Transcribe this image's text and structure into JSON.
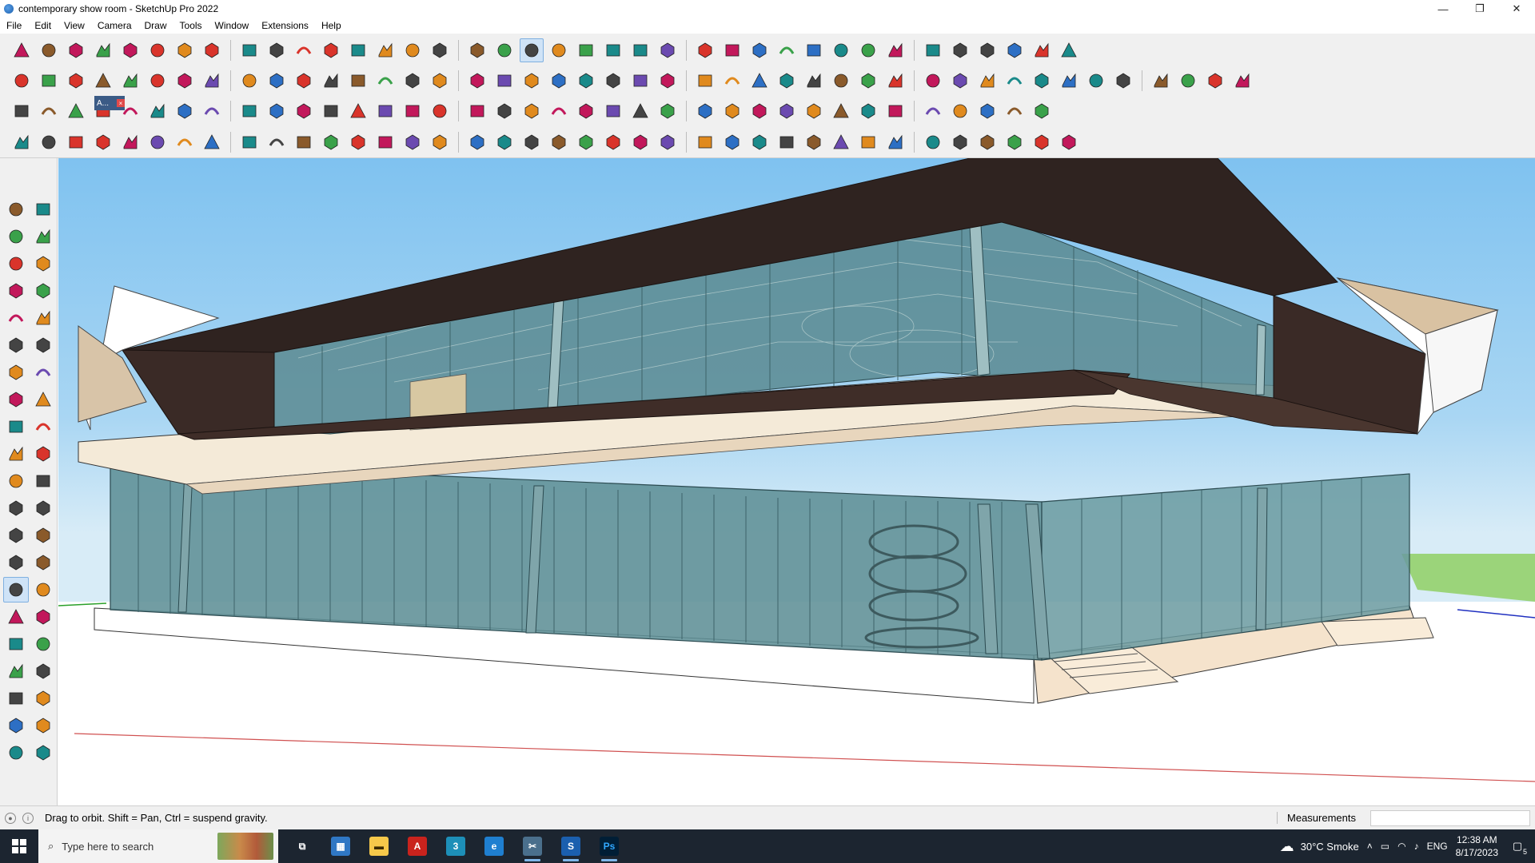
{
  "window": {
    "title": "contemporary show room - SketchUp Pro 2022",
    "minimize_glyph": "—",
    "maximize_glyph": "❐",
    "close_glyph": "✕"
  },
  "menu": [
    "File",
    "Edit",
    "View",
    "Camera",
    "Draw",
    "Tools",
    "Window",
    "Extensions",
    "Help"
  ],
  "toolbar": {
    "active_tool": "orbit-icon",
    "row1": [
      "zoom-icon",
      "select-icon",
      "select-dropdown-icon",
      "eraser-icon",
      "line-icon",
      "line-dropdown-icon",
      "arc-icon",
      "arc-dropdown-icon",
      "shape-icon",
      "shape-dropdown-icon",
      "pushpull-icon",
      "followme-icon",
      "move-icon",
      "rotate-icon",
      "scale-icon",
      "tapemeasure-icon",
      "text-icon",
      "paint-icon",
      "orbit-icon",
      "pan-icon",
      "zoom-tool-icon",
      "zoom-extents-icon",
      "geo-icon",
      "sandbox-icon",
      "layers-icon",
      "warehouse-icon",
      "user-icon",
      "user-dropdown-icon",
      "section-icon",
      "section-fill-icon",
      "solid-icon",
      "flip-icon",
      "flip2-icon",
      "axes-icon",
      "xray-icon",
      "undo-icon",
      "redo-icon",
      "hand-icon"
    ],
    "row2": [
      "component-icon",
      "component2-icon",
      "component3-icon",
      "pushpull-red-icon",
      "extrude-a-icon",
      "extrude-b-icon",
      "extrude-c-icon",
      "extrude-d-icon",
      "extrude-e-icon",
      "extrude-f-icon",
      "curve-icon",
      "wall-a-icon",
      "wall-b-icon",
      "wall-c-icon",
      "face-icon",
      "face2-icon",
      "house-a-icon",
      "house-b-icon",
      "house-c-icon",
      "house-d-icon",
      "house-e-icon",
      "house-f-icon",
      "fx-icon",
      "leaf-icon",
      "pencil-red-icon",
      "shape-a-icon",
      "shape-b-icon",
      "shape-c-icon",
      "shape-d-icon",
      "shape-e-icon",
      "shape-f-icon",
      "shape-g-icon",
      "shape-h-icon",
      "shape-i-icon",
      "shape-j-icon",
      "ruler-icon",
      "eraser-pink-icon",
      "stamp-a-icon",
      "stamp-b-icon",
      "stamp-c-icon",
      "stamp-d-icon",
      "stamp-e-icon",
      "stamp-f-icon",
      "stamp-g-icon"
    ],
    "row3": [
      "plane-a-icon",
      "plane-b-icon",
      "plane-c-icon",
      "plane-d-icon",
      "plane-e-icon",
      "arc-orange-icon",
      "rect-red-icon",
      "grid-icon",
      "panel-icon",
      "box-icon",
      "chain-icon",
      "curve2-icon",
      "spline-icon",
      "cross-red-icon",
      "cross-green-icon",
      "cross-blue-icon",
      "cone-icon",
      "cone2-icon",
      "triangle-icon",
      "loop-icon",
      "loop2-icon",
      "loop3-icon",
      "move2-icon",
      "bucket-icon",
      "undo-red-icon",
      "tree-icon",
      "cube-a-icon",
      "cube-b-icon",
      "cube-c-icon",
      "gift-icon",
      "net-icon",
      "net2-icon",
      "net3-icon",
      "net4-icon",
      "net5-icon",
      "curve3-icon",
      "dots-icon"
    ],
    "row4": [
      "path-a-icon",
      "path-b-icon",
      "car-icon",
      "tool-a-icon",
      "tool-b-icon",
      "tool-c-icon",
      "tool-d-icon",
      "tool-e-icon",
      "tool-f-icon",
      "tool-g-icon",
      "tool-h-icon",
      "tool-i-icon",
      "tool-j-icon",
      "tool-k-icon",
      "tool-l-icon",
      "tool-m-icon",
      "tool-n-icon",
      "tool-o-icon",
      "tool-p-icon",
      "tool-q-icon",
      "tool-r-icon",
      "tool-s-icon",
      "tool-t-icon",
      "tool-u-icon",
      "tool-v-icon",
      "tool-w-icon",
      "tool-x-icon",
      "tool-y-icon",
      "tool-z-icon",
      "tool-aa-icon",
      "tool-ab-icon",
      "tool-ac-icon",
      "tool-ad-icon",
      "tool-ae-icon",
      "tool-af-icon",
      "tool-ag-icon",
      "tool-ah-icon",
      "tool-ai-icon"
    ],
    "floating_panel_label": "A..."
  },
  "left_toolbar": [
    "select-icon",
    "orbit-small-icon",
    "paint-icon",
    "eraser-icon",
    "component-icon",
    "pencil-icon",
    "line-icon",
    "freehand-icon",
    "rect-icon",
    "rotated-rect-icon",
    "circle-icon",
    "polygon-icon",
    "arc-icon",
    "arc2-icon",
    "pie-icon",
    "arc3-icon",
    "move-icon",
    "pushpull-icon",
    "rotate-icon",
    "followme-icon",
    "scale-icon",
    "offset-icon",
    "tapemeasure-icon",
    "dimension-icon",
    "protractor-icon",
    "text-icon",
    "axes-icon",
    "3dtext-icon",
    "orbit-icon",
    "pan-icon",
    "zoom-icon",
    "zoom-window-icon",
    "zoom-extents-icon",
    "previous-view-icon",
    "walk-icon",
    "lookaround-icon",
    "footprints-icon",
    "position-camera-icon",
    "section-plane-icon",
    "section-display-icon",
    "section-fill-icon",
    "section-cut-icon"
  ],
  "status": {
    "hint": "Drag to orbit. Shift = Pan, Ctrl = suspend gravity.",
    "measurements_label": "Measurements",
    "measurements_value": ""
  },
  "taskbar": {
    "search_placeholder": "Type here to search",
    "apps": [
      {
        "name": "task-view",
        "glyph": "⧉",
        "color": "#ffffff",
        "bg": "transparent",
        "open": false
      },
      {
        "name": "calculator",
        "glyph": "▦",
        "color": "#ffffff",
        "bg": "#2f77c4",
        "open": false
      },
      {
        "name": "file-explorer",
        "glyph": "▬",
        "color": "#3a2a00",
        "bg": "#f6c84a",
        "open": false
      },
      {
        "name": "acrobat",
        "glyph": "A",
        "color": "#ffffff",
        "bg": "#c9231d",
        "open": false
      },
      {
        "name": "app-3",
        "glyph": "3",
        "color": "#ffffff",
        "bg": "#1d8fb8",
        "open": false
      },
      {
        "name": "edge",
        "glyph": "e",
        "color": "#ffffff",
        "bg": "#1f7fd0",
        "open": false
      },
      {
        "name": "snipping",
        "glyph": "✂",
        "color": "#ffffff",
        "bg": "#4a6f8c",
        "open": true
      },
      {
        "name": "sketchup",
        "glyph": "S",
        "color": "#ffffff",
        "bg": "#1b5fae",
        "open": true
      },
      {
        "name": "photoshop",
        "glyph": "Ps",
        "color": "#31a8ff",
        "bg": "#001e36",
        "open": true
      }
    ],
    "weather": "30°C  Smoke",
    "language": "ENG",
    "time": "12:38 AM",
    "date": "8/17/2023",
    "notification_count": "5"
  },
  "colors": {
    "roof_dark": "#3a2a26",
    "roof_top": "#2f2320",
    "glass": "#5f8f96",
    "slab_cream": "#f4ead8",
    "sky_top": "#7fc2f0",
    "ground": "#ffffff",
    "green_axis_area": "#9bd47a"
  }
}
